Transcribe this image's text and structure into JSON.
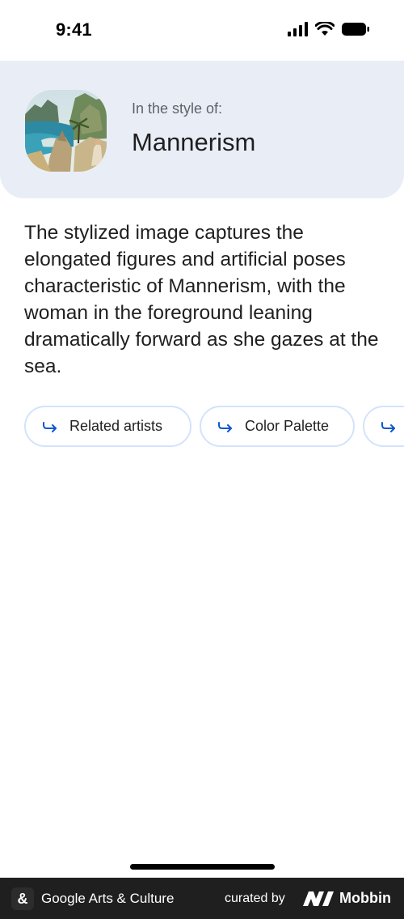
{
  "status_bar": {
    "time": "9:41"
  },
  "style_card": {
    "kicker": "In the style of:",
    "style_name": "Mannerism"
  },
  "description": "The stylized image captures the elongated figures and artificial poses characteristic of Mannerism, with the woman in the foreground leaning dramatically forward as she gazes at the sea.",
  "chips": [
    {
      "label": "Related artists",
      "icon": "forward-arrow-icon"
    },
    {
      "label": "Color Palette",
      "icon": "forward-arrow-icon"
    },
    {
      "label": "",
      "icon": "forward-arrow-icon"
    }
  ],
  "footer": {
    "brand": "Google Arts & Culture",
    "logo_glyph": "&",
    "curated_by": "curated by",
    "mobbin": "Mobbin"
  },
  "colors": {
    "card_bg": "#e9eef6",
    "chip_border": "#d3e3fd",
    "accent_blue": "#0b57d0",
    "footer_bg": "#1f1f1f"
  }
}
